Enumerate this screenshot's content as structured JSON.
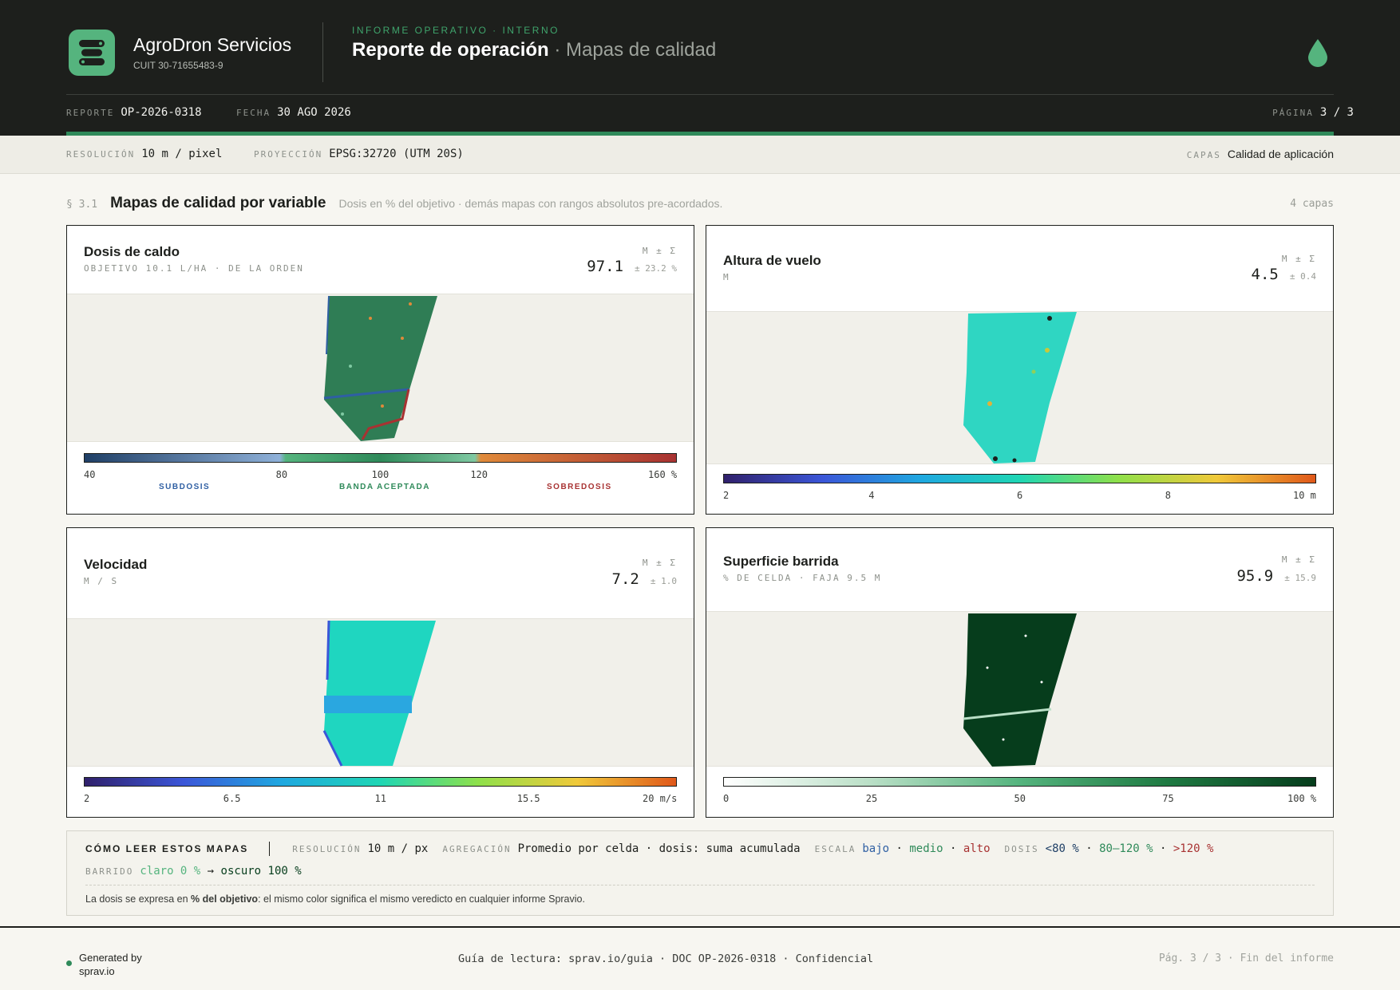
{
  "header": {
    "brand": "AgroDron Servicios",
    "cuit": "CUIT 30-71655483-9",
    "eyebrow": "INFORME OPERATIVO · INTERNO",
    "title": "Reporte de operación",
    "subtitle": "· Mapas de calidad",
    "report_label": "REPORTE",
    "report_value": "OP-2026-0318",
    "date_label": "FECHA",
    "date_value": "30 AGO 2026",
    "page_label": "PÁGINA",
    "page_value": "3 / 3",
    "icons": {
      "logo": "app-logo-icon",
      "drop": "water-drop-icon"
    },
    "colors": {
      "dark": "#1d1f1c",
      "accent": "#2f8a5a",
      "logo": "#55b47e"
    }
  },
  "subbar": {
    "resolution_label": "RESOLUCIÓN",
    "resolution_value": "10 m / pixel",
    "projection_label": "PROYECCIÓN",
    "projection_value": "EPSG:32720 (UTM 20S)",
    "layers_label": "CAPAS",
    "layers_value": "Calidad de aplicación"
  },
  "section": {
    "number": "§ 3.1",
    "title": "Mapas de calidad por variable",
    "subtitle": "Dosis en % del objetivo · demás mapas con rangos absolutos pre-acordados.",
    "count": "4 capas"
  },
  "cards": [
    {
      "title": "Dosis de caldo",
      "subtitle": "OBJETIVO 10.1 L/HA · DE LA ORDEN",
      "ms_label": "M ± Σ",
      "mean": "97.1",
      "sd": "± 23.2 %",
      "ticks": [
        "40",
        "80",
        "100",
        "120",
        "160 %"
      ],
      "tick_values": [
        40,
        80,
        100,
        120,
        160
      ],
      "range": [
        40,
        160
      ],
      "zones": [
        "SUBDOSIS",
        "BANDA ACEPTADA",
        "SOBREDOSIS"
      ]
    },
    {
      "title": "Altura de vuelo",
      "subtitle": "M",
      "ms_label": "M ± Σ",
      "mean": "4.5",
      "sd": "± 0.4",
      "ticks": [
        "2",
        "4",
        "6",
        "8",
        "10 m"
      ],
      "tick_values": [
        2,
        4,
        6,
        8,
        10
      ],
      "range": [
        2,
        10
      ]
    },
    {
      "title": "Velocidad",
      "subtitle": "M / S",
      "ms_label": "M ± Σ",
      "mean": "7.2",
      "sd": "± 1.0",
      "ticks": [
        "2",
        "6.5",
        "11",
        "15.5",
        "20 m/s"
      ],
      "tick_values": [
        2,
        6.5,
        11,
        15.5,
        20
      ],
      "range": [
        2,
        20
      ]
    },
    {
      "title": "Superficie barrida",
      "subtitle": "% DE CELDA · FAJA 9.5 M",
      "ms_label": "M ± Σ",
      "mean": "95.9",
      "sd": "± 15.9",
      "ticks": [
        "0",
        "25",
        "50",
        "75",
        "100 %"
      ],
      "tick_values": [
        0,
        25,
        50,
        75,
        100
      ],
      "range": [
        0,
        100
      ]
    }
  ],
  "legend": {
    "title": "CÓMO LEER ESTOS MAPAS",
    "resolution_label": "RESOLUCIÓN",
    "resolution_value": "10 m / px",
    "aggregation_label": "AGREGACIÓN",
    "aggregation_value": "Promedio por celda · dosis: suma acumulada",
    "scale_label": "ESCALA",
    "scale_low": "bajo",
    "scale_mid": "medio",
    "scale_high": "alto",
    "dose_label": "DOSIS",
    "dose_low": "<80 %",
    "dose_mid": "80–120 %",
    "dose_high": ">120 %",
    "sweep_label": "BARRIDO",
    "sweep_light": "claro 0 %",
    "sweep_arrow": "→",
    "sweep_dark": "oscuro 100 %",
    "note_pre": "La dosis se expresa en ",
    "note_bold": "% del objetivo",
    "note_post": ": el mismo color significa el mismo veredicto en cualquier informe Spravio.",
    "colors": {
      "low": "#2f5fa3",
      "mid": "#2f8a5a",
      "high": "#a83232"
    }
  },
  "footer": {
    "generated": "Generated by sprav.io",
    "center": "Guía de lectura: sprav.io/guia · DOC OP-2026-0318 · Confidencial",
    "right": "Pág. 3 / 3 · Fin del informe"
  }
}
